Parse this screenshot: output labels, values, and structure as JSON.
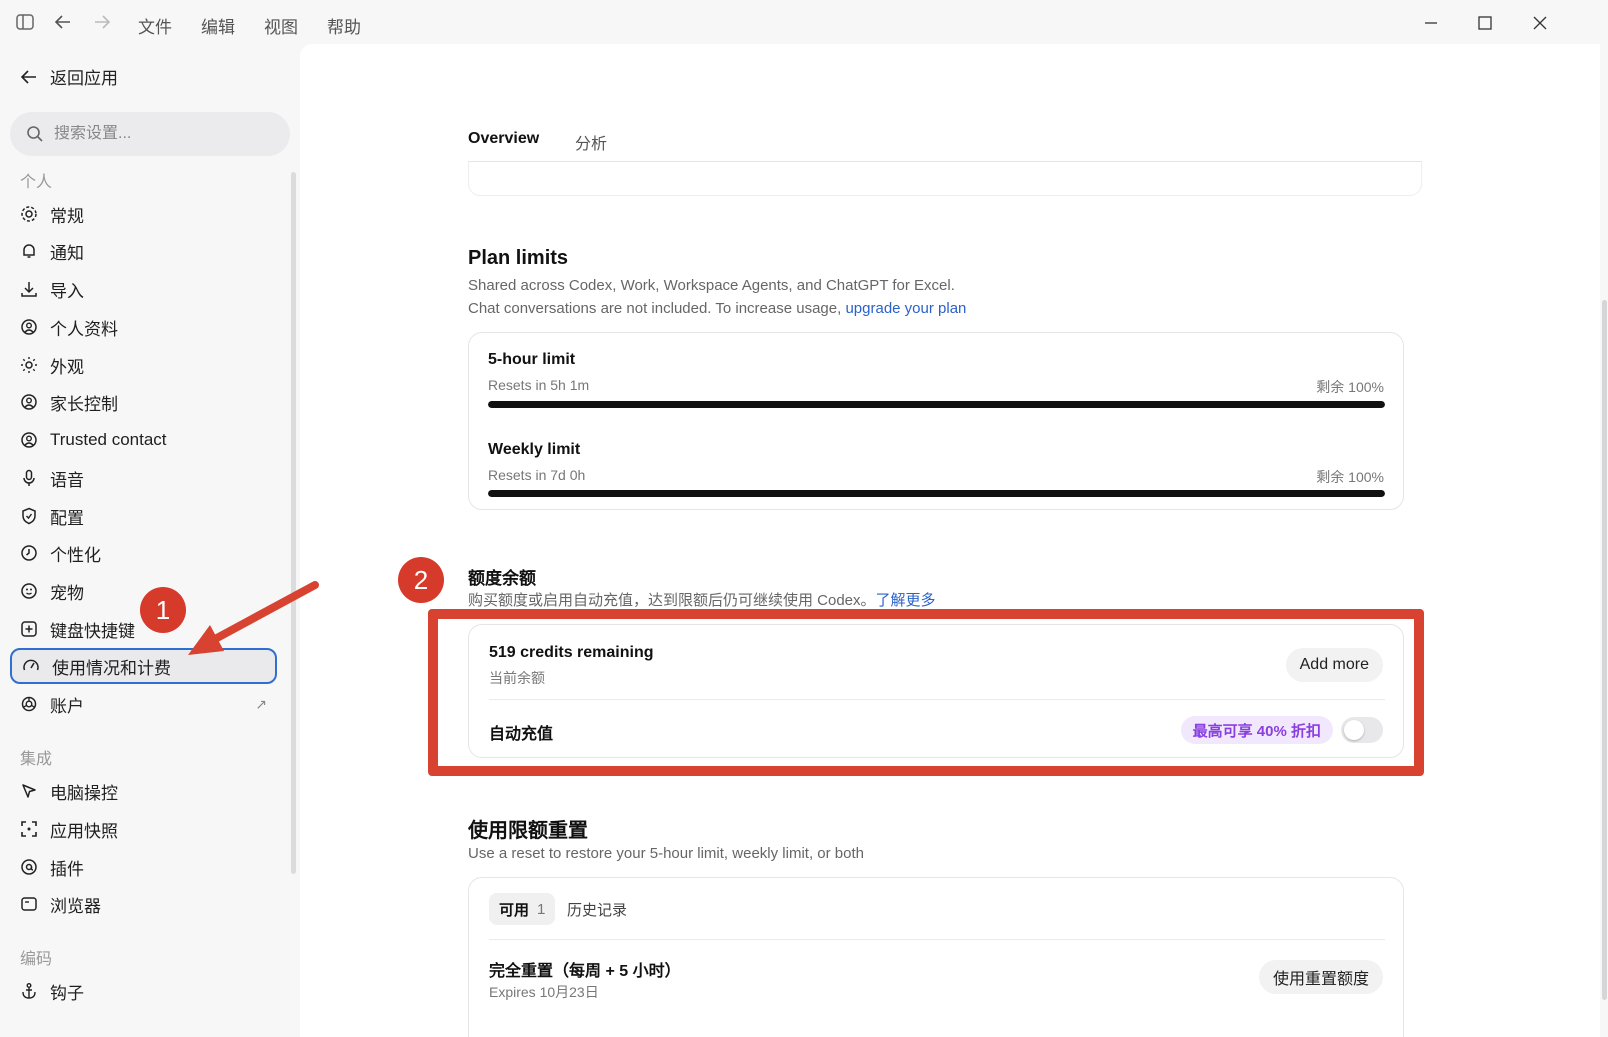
{
  "titlebar": {
    "menus": [
      "文件",
      "编辑",
      "视图",
      "帮助"
    ]
  },
  "sidebar": {
    "back_label": "返回应用",
    "search_placeholder": "搜索设置...",
    "sections": [
      {
        "label": "个人"
      },
      {
        "label": "集成"
      },
      {
        "label": "编码"
      }
    ],
    "items": [
      {
        "label": "常规",
        "icon": "gear-icon"
      },
      {
        "label": "通知",
        "icon": "bell-icon"
      },
      {
        "label": "导入",
        "icon": "download-icon"
      },
      {
        "label": "个人资料",
        "icon": "user-circle-icon"
      },
      {
        "label": "外观",
        "icon": "sun-icon"
      },
      {
        "label": "家长控制",
        "icon": "user-circle-icon"
      },
      {
        "label": "Trusted contact",
        "icon": "user-circle-icon"
      },
      {
        "label": "语音",
        "icon": "mic-icon"
      },
      {
        "label": "配置",
        "icon": "shield-icon"
      },
      {
        "label": "个性化",
        "icon": "clock-icon"
      },
      {
        "label": "宠物",
        "icon": "paw-icon"
      },
      {
        "label": "键盘快捷键",
        "icon": "keyboard-icon"
      },
      {
        "label": "使用情况和计费",
        "icon": "gauge-icon"
      },
      {
        "label": "账户",
        "icon": "openai-icon"
      },
      {
        "label": "电脑操控",
        "icon": "cursor-icon"
      },
      {
        "label": "应用快照",
        "icon": "snapshot-icon"
      },
      {
        "label": "插件",
        "icon": "at-icon"
      },
      {
        "label": "浏览器",
        "icon": "browser-icon"
      },
      {
        "label": "钩子",
        "icon": "anchor-icon"
      }
    ]
  },
  "main": {
    "tabs": [
      {
        "label": "Overview"
      },
      {
        "label": "分析"
      }
    ],
    "plan_limits": {
      "title": "Plan limits",
      "desc_line1": "Shared across Codex, Work, Workspace Agents, and ChatGPT for Excel.",
      "desc_line2": "Chat conversations are not included. To increase usage, ",
      "desc_link": "upgrade your plan",
      "limits": [
        {
          "title": "5-hour limit",
          "reset": "Resets in 5h 1m",
          "remaining": "剩余 100%",
          "fraction": 1.0
        },
        {
          "title": "Weekly limit",
          "reset": "Resets in 7d 0h",
          "remaining": "剩余 100%",
          "fraction": 1.0
        }
      ]
    },
    "credits": {
      "title": "额度余额",
      "desc": "购买额度或启用自动充值，达到限额后仍可继续使用 Codex。",
      "desc_link": "了解更多",
      "remaining_title": "519 credits remaining",
      "remaining_sub": "当前余额",
      "add_more": "Add more",
      "auto_label": "自动充值",
      "promo": "最高可享 40% 折扣",
      "auto_enabled": false
    },
    "resets": {
      "title": "使用限额重置",
      "desc": "Use a reset to restore your 5-hour limit, weekly limit, or both",
      "tab_available": "可用",
      "tab_available_count": "1",
      "tab_history": "历史记录",
      "item_title": "完全重置（每周 + 5 小时）",
      "item_expires": "Expires 10月23日",
      "item_button": "使用重置额度"
    }
  },
  "annotations": {
    "step1": "1",
    "step2": "2",
    "accent": "#d84230"
  }
}
